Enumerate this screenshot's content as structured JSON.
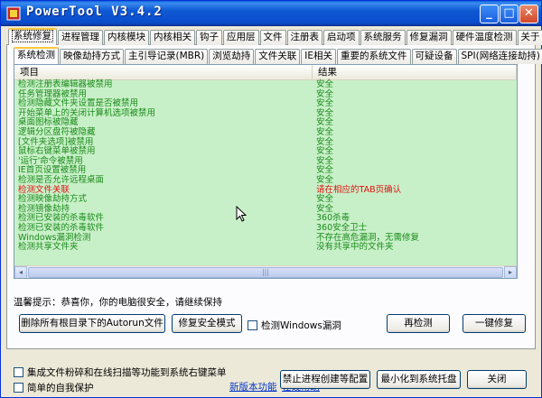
{
  "window": {
    "title": "PowerTool V3.4.2",
    "minimize": "_",
    "maximize": "□",
    "close": "✕"
  },
  "tabs_main": [
    {
      "label": "系统修复",
      "active": true
    },
    {
      "label": "进程管理"
    },
    {
      "label": "内核模块"
    },
    {
      "label": "内核相关"
    },
    {
      "label": "钩子"
    },
    {
      "label": "应用层"
    },
    {
      "label": "文件"
    },
    {
      "label": "注册表"
    },
    {
      "label": "启动项"
    },
    {
      "label": "系统服务"
    },
    {
      "label": "修复漏洞"
    },
    {
      "label": "硬件温度检测"
    },
    {
      "label": "关于"
    }
  ],
  "tabs_sub": [
    {
      "label": "系统检测",
      "active": true
    },
    {
      "label": "映像劫持方式"
    },
    {
      "label": "主引导记录(MBR)"
    },
    {
      "label": "浏览劫持"
    },
    {
      "label": "文件关联"
    },
    {
      "label": "IE相关"
    },
    {
      "label": "重要的系统文件"
    },
    {
      "label": "可疑设备"
    },
    {
      "label": "SPI(网络连接劫持)"
    }
  ],
  "table": {
    "col_item": "项目",
    "col_result": "结果",
    "rows": [
      {
        "item": "检测注册表编辑器被禁用",
        "result": "安全",
        "status": "ok"
      },
      {
        "item": "任务管理器被禁用",
        "result": "安全",
        "status": "ok"
      },
      {
        "item": "检测隐藏文件夹设置是否被禁用",
        "result": "安全",
        "status": "ok"
      },
      {
        "item": "开始菜单上的关闭计算机选项被禁用",
        "result": "安全",
        "status": "ok"
      },
      {
        "item": "桌面图标被隐藏",
        "result": "安全",
        "status": "ok"
      },
      {
        "item": "逻辑分区盘符被隐藏",
        "result": "安全",
        "status": "ok"
      },
      {
        "item": "[文件夹选项]被禁用",
        "result": "安全",
        "status": "ok"
      },
      {
        "item": "鼠标右键菜单被禁用",
        "result": "安全",
        "status": "ok"
      },
      {
        "item": "'运行'命令被禁用",
        "result": "安全",
        "status": "ok"
      },
      {
        "item": "IE首页设置被禁用",
        "result": "安全",
        "status": "ok"
      },
      {
        "item": "检测是否允许远程桌面",
        "result": "安全",
        "status": "ok"
      },
      {
        "item": "检测文件关联",
        "result": "请在相应的TAB页确认",
        "status": "warn"
      },
      {
        "item": "检测映像劫持方式",
        "result": "安全",
        "status": "ok"
      },
      {
        "item": "检测镜像劫持",
        "result": "安全",
        "status": "ok"
      },
      {
        "item": "检测已安装的杀毒软件",
        "result": "360杀毒",
        "status": "ok"
      },
      {
        "item": "检测已安装的杀毒软件",
        "result": "360安全卫士",
        "status": "ok"
      },
      {
        "item": "Windows漏洞检测",
        "result": "不存在高危漏洞，无需修复",
        "status": "ok"
      },
      {
        "item": "检测共享文件夹",
        "result": "没有共享中的文件夹",
        "status": "ok"
      }
    ]
  },
  "scroll": {
    "left": "◂",
    "right": "▸",
    "grip": "|||"
  },
  "tip": "温馨提示：恭喜你，你的电脑很安全，请继续保持",
  "buttons": {
    "delete_autorun": "删除所有根目录下的Autorun文件",
    "repair_safe_mode": "修复安全模式",
    "recheck": "再检测",
    "one_key_repair": "一键修复",
    "forbid_process": "禁止进程创建等配置",
    "minimize_tray": "最小化到系统托盘",
    "close": "关闭"
  },
  "checks": {
    "check_windows_vuln": "检测Windows漏洞",
    "integrate_context_menu": "集成文件粉碎和在线扫描等功能到系统右键菜单",
    "simple_self_protect": "简单的自我保护"
  },
  "links": {
    "new_version": "新版本功能",
    "online_help": "在线帮助"
  }
}
